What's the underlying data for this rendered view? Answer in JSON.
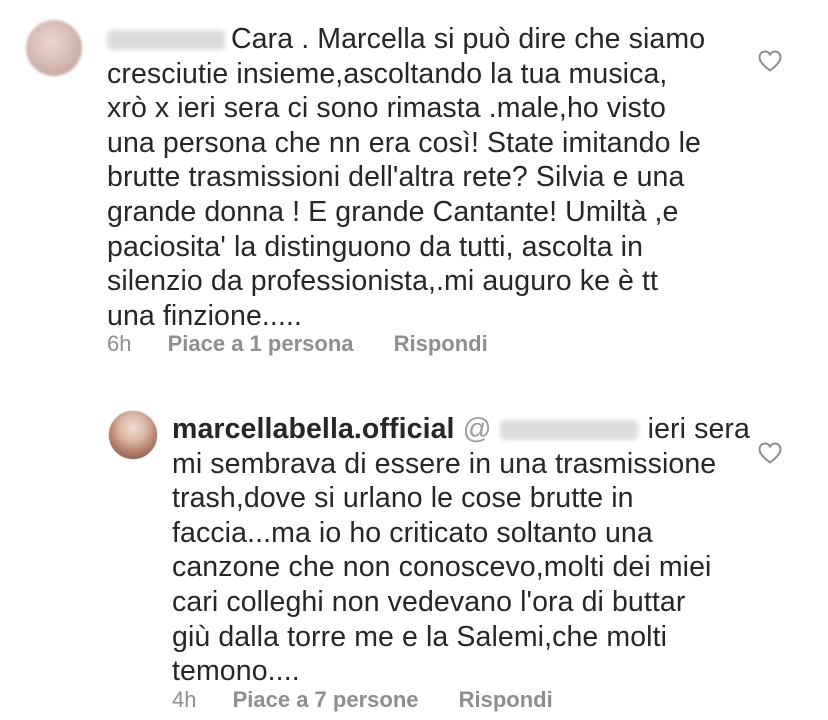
{
  "comments": [
    {
      "mention_hidden": "",
      "lines": [
        "Cara . Marcella si può dire che siamo",
        "cresciutie insieme,ascoltando la tua musica,",
        "xrò x ieri sera ci sono rimasta .male,ho visto",
        "una persona che nn era così! State imitando le",
        "brutte trasmissioni dell'altra rete? Silvia e una",
        "grande donna ! E grande Cantante! Umiltà ,e",
        "paciosita' la distinguono da tutti, ascolta in",
        "silenzio da professionista,.mi auguro ke è tt",
        "una finzione....."
      ],
      "time": "6h",
      "likes": "Piace a 1 persona",
      "reply": "Rispondi",
      "heart_icon": "heart-outline-icon"
    },
    {
      "username": "marcellabella.official",
      "mention_prefix": "@",
      "lines": [
        "ieri sera",
        "mi sembrava di essere in una trasmissione",
        "trash,dove si urlano le cose brutte in",
        "faccia...ma io ho criticato soltanto una",
        "canzone che non conoscevo,molti dei miei",
        "cari colleghi non vedevano l'ora di buttar",
        "giù dalla torre me e la Salemi,che molti",
        "temono...."
      ],
      "time": "4h",
      "likes": "Piace a 7 persone",
      "reply": "Rispondi",
      "heart_icon": "heart-outline-icon"
    }
  ],
  "colors": {
    "text": "#262626",
    "meta": "#8e8e8e",
    "background": "#ffffff"
  }
}
